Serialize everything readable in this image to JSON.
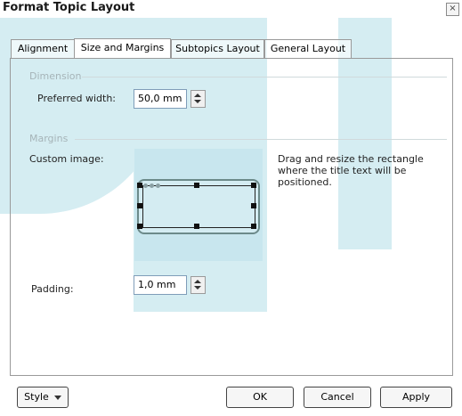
{
  "window": {
    "title": "Format Topic Layout"
  },
  "tabs": [
    {
      "label": "Alignment"
    },
    {
      "label": "Size and Margins"
    },
    {
      "label": "Subtopics Layout"
    },
    {
      "label": "General Layout"
    }
  ],
  "dimension": {
    "group_label": "Dimension",
    "preferred_width_label": "Preferred width:",
    "preferred_width_value": "50,0 mm"
  },
  "margins": {
    "group_label": "Margins",
    "custom_image_label": "Custom image:",
    "help_text": "Drag and resize the rectangle where the title text will be positioned.",
    "padding_label": "Padding:",
    "padding_value": "1,0 mm"
  },
  "footer": {
    "style_label": "Style",
    "ok_label": "OK",
    "cancel_label": "Cancel",
    "apply_label": "Apply"
  },
  "colors": {
    "background_accent": "#d5edf2",
    "image_area": "#c8e6ee"
  },
  "icons": {
    "close": "close-icon",
    "spin": "spin-up-down-icon",
    "dropdown": "chevron-down-icon"
  }
}
